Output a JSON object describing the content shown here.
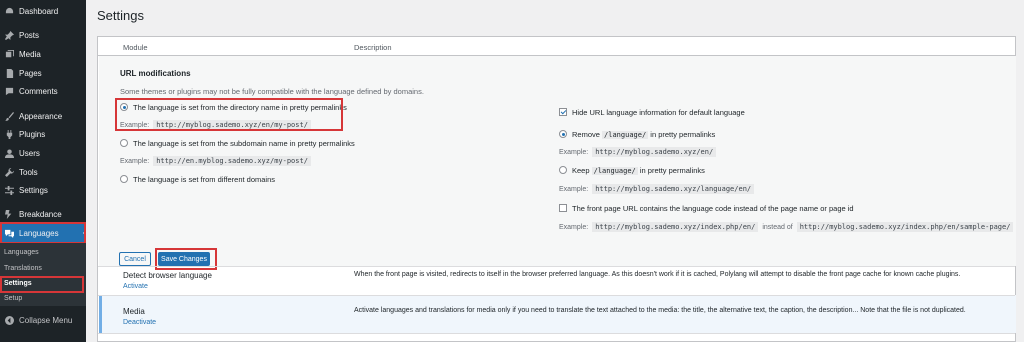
{
  "sidebar": {
    "items": [
      {
        "label": "Dashboard",
        "icon": "dashboard-icon"
      },
      {
        "label": "Posts",
        "icon": "pin-icon"
      },
      {
        "label": "Media",
        "icon": "media-icon"
      },
      {
        "label": "Pages",
        "icon": "page-icon"
      },
      {
        "label": "Comments",
        "icon": "comment-icon"
      },
      {
        "label": "Appearance",
        "icon": "brush-icon"
      },
      {
        "label": "Plugins",
        "icon": "plugin-icon"
      },
      {
        "label": "Users",
        "icon": "user-icon"
      },
      {
        "label": "Tools",
        "icon": "wrench-icon"
      },
      {
        "label": "Settings",
        "icon": "settings-icon"
      },
      {
        "label": "Breakdance",
        "icon": "breakdance-icon"
      },
      {
        "label": "Languages",
        "icon": "languages-icon"
      }
    ],
    "submenu": [
      "Languages",
      "Translations",
      "Settings",
      "Setup"
    ],
    "collapse_label": "Collapse Menu",
    "accent": "#2271b1"
  },
  "page": {
    "title": "Settings",
    "col_module": "Module",
    "col_description": "Description"
  },
  "url_mod": {
    "title": "URL modifications",
    "warning": "Some themes or plugins may not be fully compatible with the language defined by domains.",
    "opt_directory": "The language is set from the directory name in pretty permalinks",
    "example_label": "Example:",
    "ex_directory": "http://myblog.sademo.xyz/en/my-post/",
    "opt_subdomain": "The language is set from the subdomain name in pretty permalinks",
    "ex_subdomain": "http://en.myblog.sademo.xyz/my-post/",
    "opt_domains": "The language is set from different domains",
    "hide_default": "Hide URL language information for default language",
    "remove_prefix": "Remove",
    "remove_code": "/language/",
    "remove_suffix": "in pretty permalinks",
    "ex_remove": "http://myblog.sademo.xyz/en/",
    "keep_prefix": "Keep",
    "keep_code": "/language/",
    "keep_suffix": "in pretty permalinks",
    "ex_keep": "http://myblog.sademo.xyz/language/en/",
    "front_page": "The front page URL contains the language code instead of the page name or page id",
    "ex_front_a": "http://myblog.sademo.xyz/index.php/en/",
    "instead_of": "instead of",
    "ex_front_b": "http://myblog.sademo.xyz/index.php/en/sample-page/",
    "cancel": "Cancel",
    "save": "Save Changes"
  },
  "modules": [
    {
      "name": "Detect browser language",
      "action": "Activate",
      "description": "When the front page is visited, redirects to itself in the browser preferred language. As this doesn't work if it is cached, Polylang will attempt to disable the front page cache for known cache plugins."
    },
    {
      "name": "Media",
      "action": "Deactivate",
      "description": "Activate languages and translations for media only if you need to translate the text attached to the media: the title, the alternative text, the caption, the description... Note that the file is not duplicated."
    }
  ],
  "colors": {
    "highlight": "#d63638",
    "sidebar_bg": "#1d2327",
    "link": "#2271b1"
  }
}
